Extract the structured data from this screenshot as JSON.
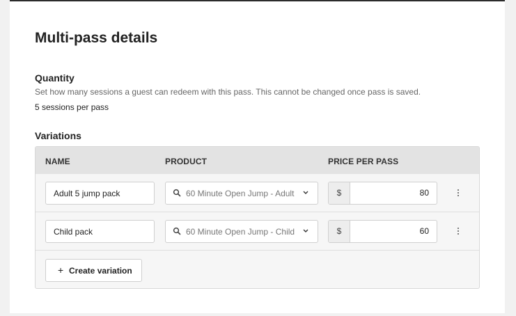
{
  "page": {
    "title": "Multi-pass details"
  },
  "quantity": {
    "label": "Quantity",
    "help": "Set how many sessions a guest can redeem with this pass. This cannot be changed once pass is saved.",
    "value": "5 sessions per pass"
  },
  "variations": {
    "label": "Variations",
    "columns": {
      "name": "NAME",
      "product": "PRODUCT",
      "price": "PRICE PER PASS"
    },
    "rows": [
      {
        "name": "Adult 5 jump pack",
        "product": "60 Minute Open Jump - Adult",
        "currency": "$",
        "price": "80"
      },
      {
        "name": "Child pack",
        "product": "60 Minute Open Jump - Child",
        "currency": "$",
        "price": "60"
      }
    ],
    "create_label": "Create variation",
    "icons": {
      "search": "search-icon",
      "chevron": "chevron-down-icon",
      "more": "more-vertical-icon",
      "add": "plus-icon"
    }
  }
}
